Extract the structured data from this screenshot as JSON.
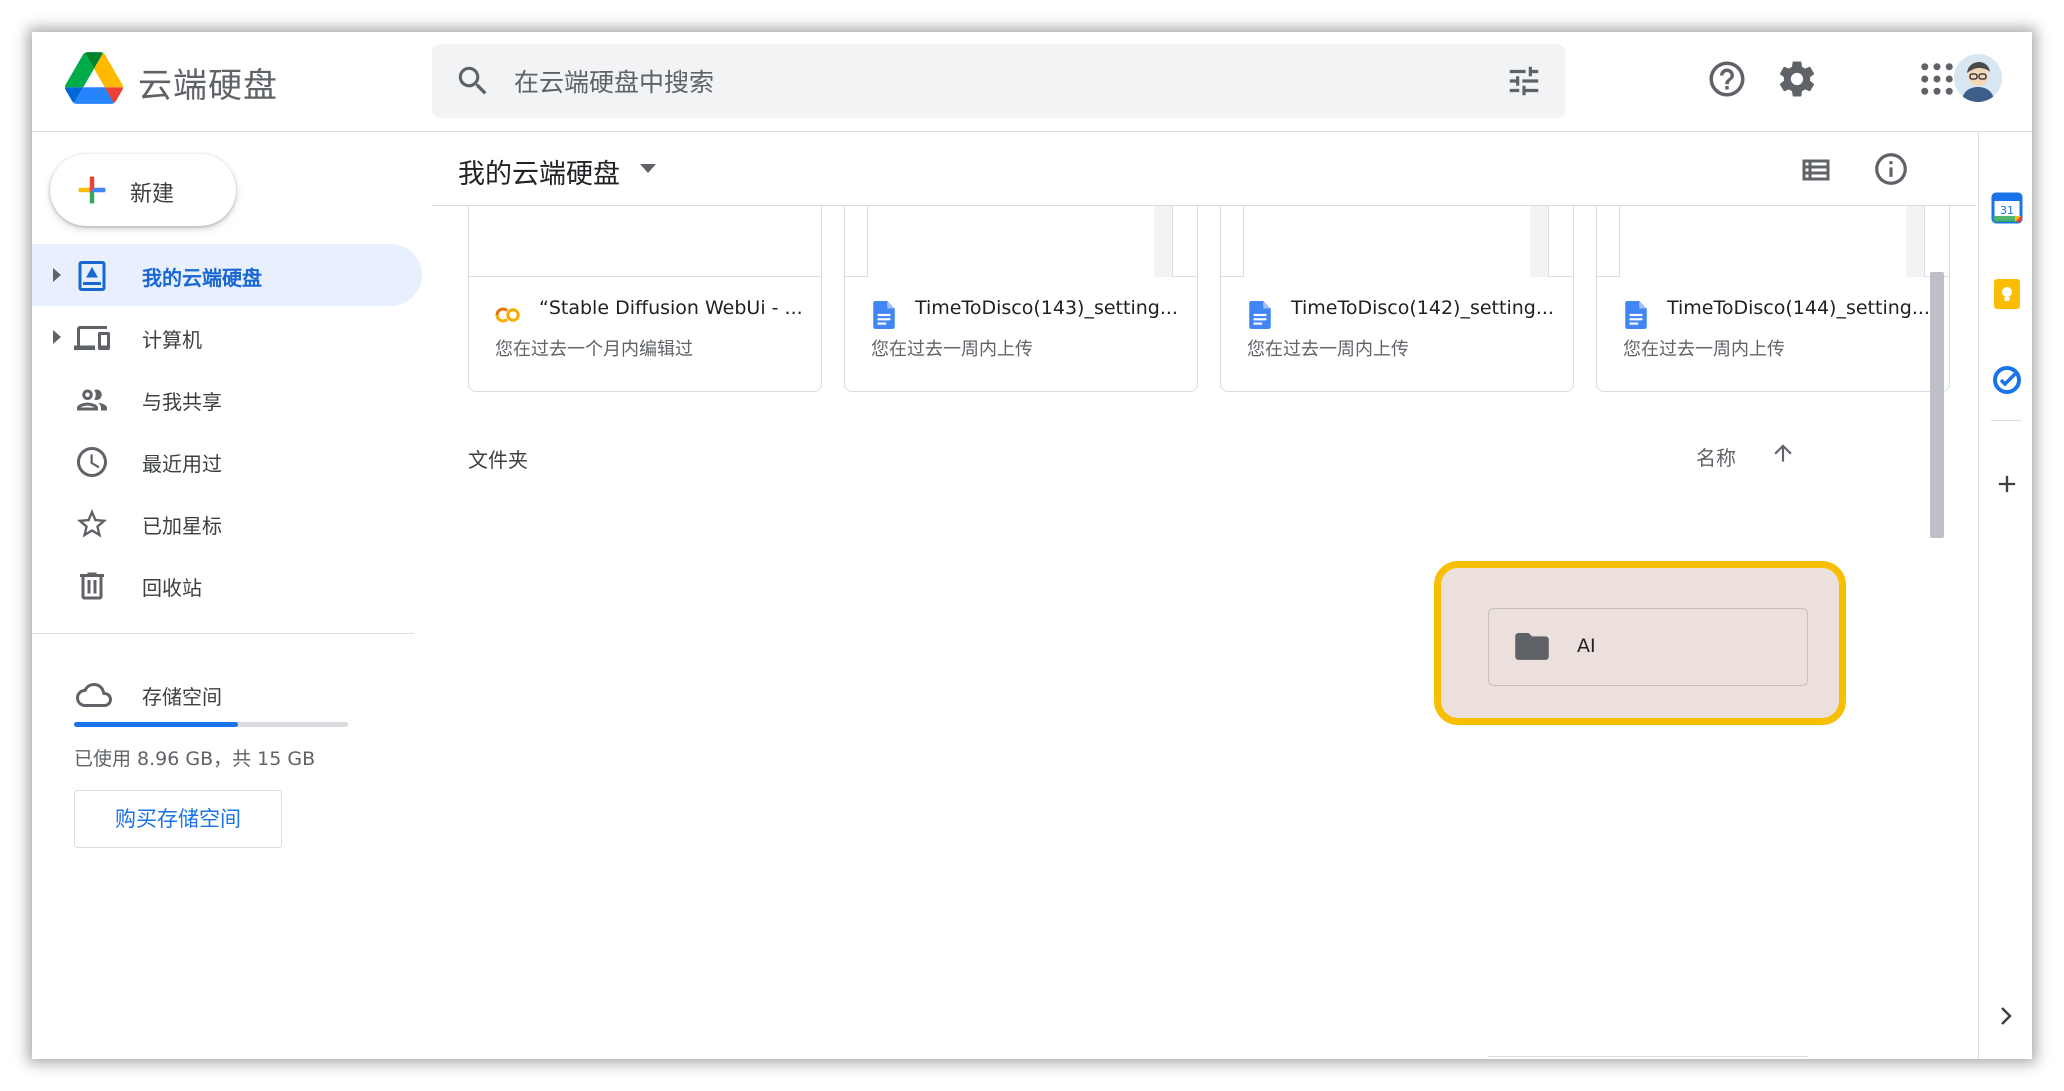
{
  "header": {
    "app_title": "云端硬盘",
    "search_placeholder": "在云端硬盘中搜索",
    "icons": [
      "drive-logo",
      "search-icon",
      "tune-icon",
      "help-icon",
      "gear-icon",
      "apps-grid-icon",
      "avatar"
    ]
  },
  "sidebar": {
    "new_label": "新建",
    "items": [
      {
        "label": "我的云端硬盘",
        "icon": "my-drive-icon",
        "active": true,
        "expandable": true
      },
      {
        "label": "计算机",
        "icon": "computer-icon",
        "active": false,
        "expandable": true
      },
      {
        "label": "与我共享",
        "icon": "people-icon",
        "active": false,
        "expandable": false
      },
      {
        "label": "最近用过",
        "icon": "clock-icon",
        "active": false,
        "expandable": false
      },
      {
        "label": "已加星标",
        "icon": "star-icon",
        "active": false,
        "expandable": false
      },
      {
        "label": "回收站",
        "icon": "trash-icon",
        "active": false,
        "expandable": false
      }
    ],
    "storage_label": "存储空间",
    "storage_used_text": "已使用 8.96 GB，共 15 GB",
    "storage_fraction": 0.597,
    "buy_label": "购买存储空间"
  },
  "main": {
    "title": "我的云端硬盘",
    "suggested": [
      {
        "name": "“Stable Diffusion WebUi - ...",
        "sub": "您在过去一个月内编辑过",
        "type": "colab"
      },
      {
        "name": "TimeToDisco(143)_setting...",
        "sub": "您在过去一周内上传",
        "type": "doc"
      },
      {
        "name": "TimeToDisco(142)_setting...",
        "sub": "您在过去一周内上传",
        "type": "doc"
      },
      {
        "name": "TimeToDisco(144)_setting...",
        "sub": "您在过去一周内上传",
        "type": "doc"
      }
    ],
    "folders_label": "文件夹",
    "sort_label": "名称",
    "folder": {
      "name": "AI"
    }
  },
  "colors": {
    "accent": "#1a73e8",
    "active_bg": "#e8f0fe",
    "highlight_border": "#f8bf00",
    "highlight_bg": "#ebe0dc"
  }
}
